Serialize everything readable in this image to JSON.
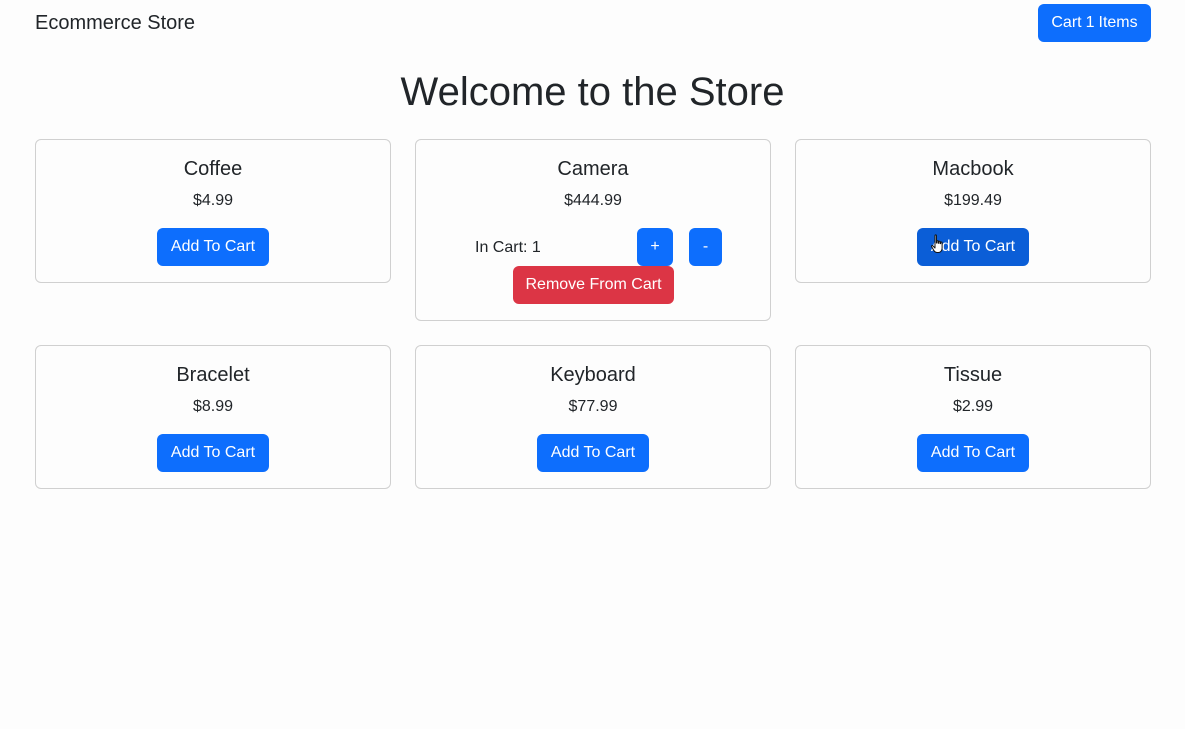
{
  "navbar": {
    "brand": "Ecommerce Store",
    "cart_label": "Cart",
    "cart_count": "1",
    "cart_suffix": "Items"
  },
  "page": {
    "title": "Welcome to the Store"
  },
  "products": [
    {
      "name": "Coffee",
      "price": "$4.99",
      "add_label": "Add To Cart"
    },
    {
      "name": "Camera",
      "price": "$444.99",
      "in_cart_label": "In Cart: 1",
      "plus_label": "+",
      "minus_label": "-",
      "remove_label": "Remove From Cart"
    },
    {
      "name": "Macbook",
      "price": "$199.49",
      "add_label": "Add To Cart"
    },
    {
      "name": "Bracelet",
      "price": "$8.99",
      "add_label": "Add To Cart"
    },
    {
      "name": "Keyboard",
      "price": "$77.99",
      "add_label": "Add To Cart"
    },
    {
      "name": "Tissue",
      "price": "$2.99",
      "add_label": "Add To Cart"
    }
  ],
  "colors": {
    "primary": "#0d6efd",
    "danger": "#dc3545",
    "text": "#212529",
    "card_border": "#d0d0d0"
  },
  "icons": {
    "cursor": "hand-pointer-icon"
  }
}
